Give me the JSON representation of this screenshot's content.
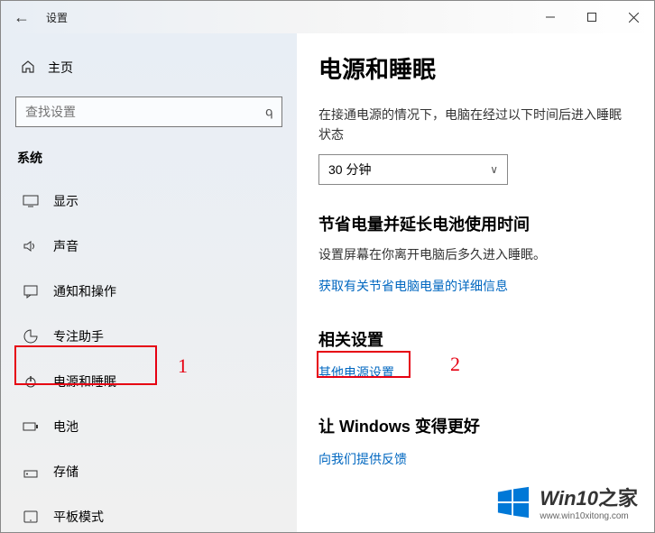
{
  "window": {
    "title": "设置"
  },
  "sidebar": {
    "home_label": "主页",
    "search_placeholder": "查找设置",
    "section_label": "系统",
    "items": [
      {
        "label": "显示",
        "icon": "display"
      },
      {
        "label": "声音",
        "icon": "sound"
      },
      {
        "label": "通知和操作",
        "icon": "notifications"
      },
      {
        "label": "专注助手",
        "icon": "focus"
      },
      {
        "label": "电源和睡眠",
        "icon": "power"
      },
      {
        "label": "电池",
        "icon": "battery"
      },
      {
        "label": "存储",
        "icon": "storage"
      },
      {
        "label": "平板模式",
        "icon": "tablet"
      }
    ]
  },
  "content": {
    "title": "电源和睡眠",
    "plugged_desc": "在接通电源的情况下，电脑在经过以下时间后进入睡眠状态",
    "sleep_value": "30 分钟",
    "save_heading": "节省电量并延长电池使用时间",
    "save_desc": "设置屏幕在你离开电脑后多久进入睡眠。",
    "save_link": "获取有关节省电脑电量的详细信息",
    "related_heading": "相关设置",
    "related_link": "其他电源设置",
    "improve_heading": "让 Windows 变得更好",
    "feedback_link": "向我们提供反馈"
  },
  "annotations": {
    "one": "1",
    "two": "2"
  },
  "watermark": {
    "brand": "Win10",
    "suffix": "之家",
    "url": "www.win10xitong.com"
  }
}
